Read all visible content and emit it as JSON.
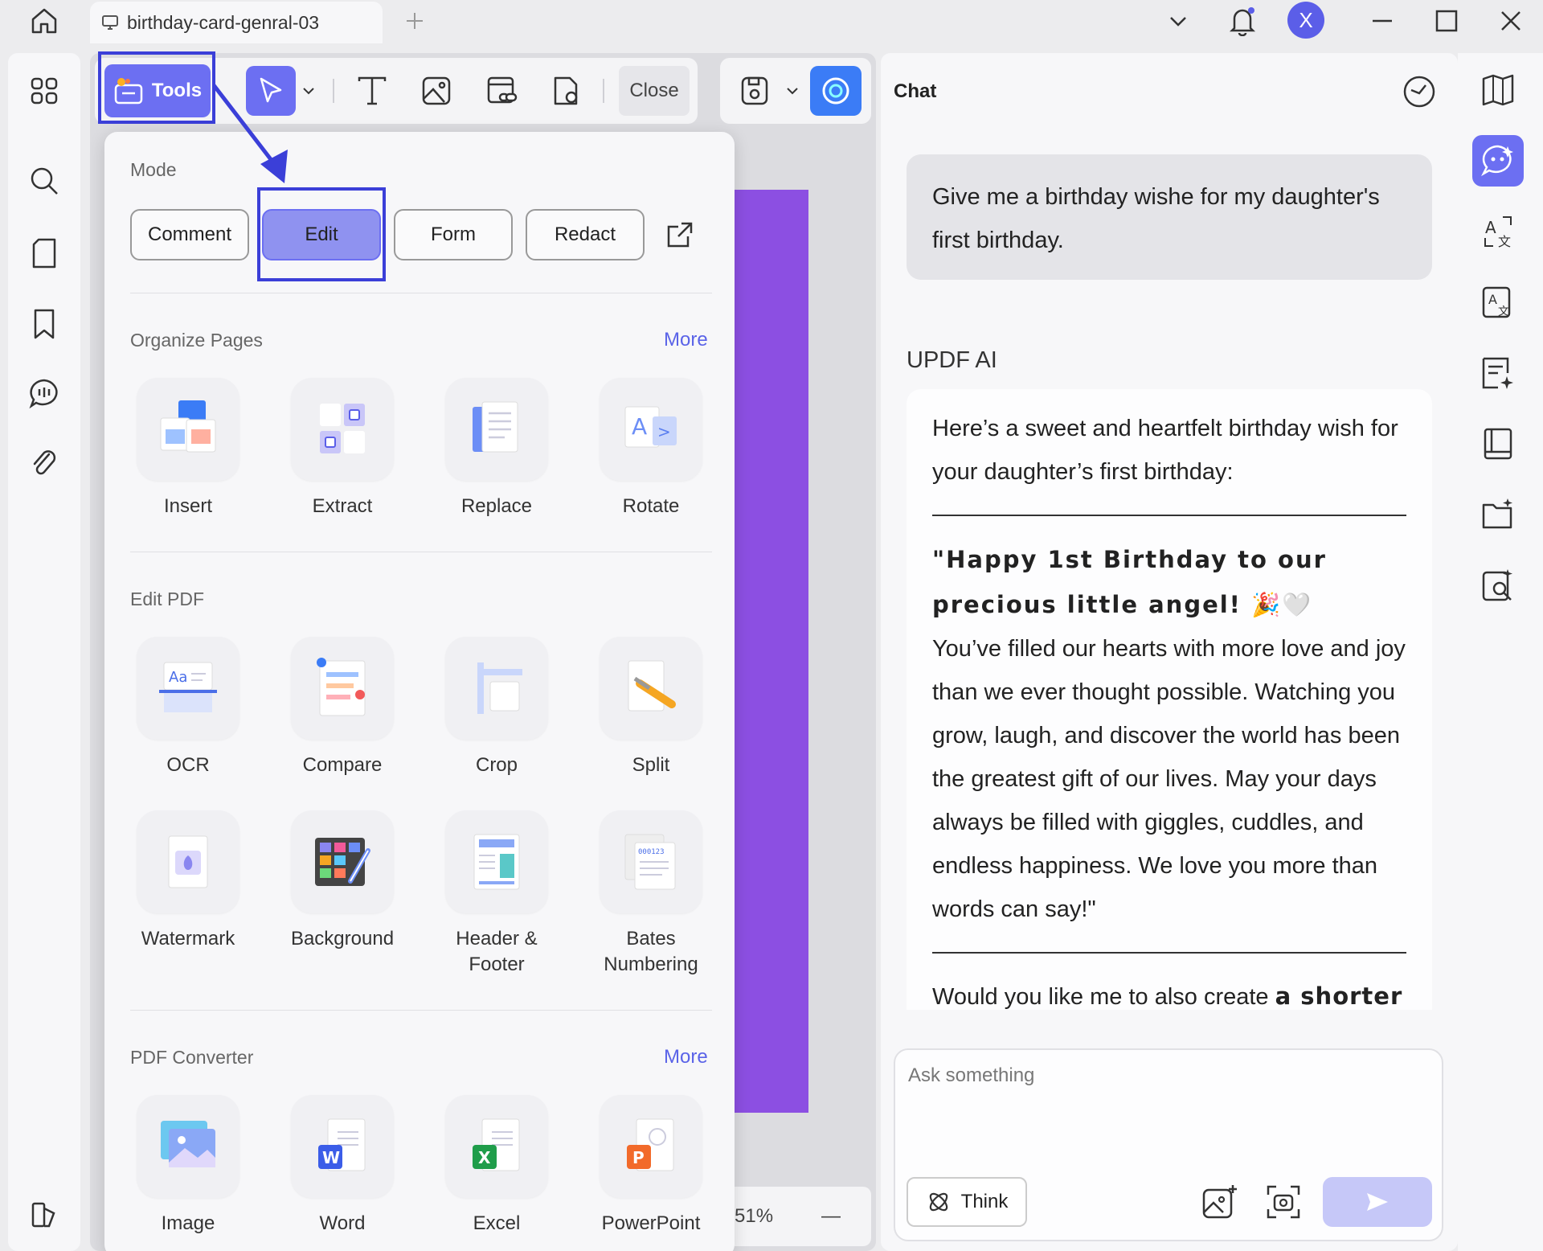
{
  "tab": {
    "title": "birthday-card-genral-03"
  },
  "user": {
    "avatar_initial": "X"
  },
  "toolbar": {
    "tools_label": "Tools",
    "close_label": "Close"
  },
  "zoom": {
    "value": "51%",
    "minus": "—"
  },
  "tools_panel": {
    "mode_title": "Mode",
    "modes": [
      "Comment",
      "Edit",
      "Form",
      "Redact"
    ],
    "organize": {
      "title": "Organize Pages",
      "more": "More",
      "items": [
        "Insert",
        "Extract",
        "Replace",
        "Rotate"
      ]
    },
    "edit_pdf": {
      "title": "Edit PDF",
      "items": [
        "OCR",
        "Compare",
        "Crop",
        "Split"
      ],
      "items2": [
        {
          "l1": "Watermark",
          "l2": ""
        },
        {
          "l1": "Background",
          "l2": ""
        },
        {
          "l1": "Header &",
          "l2": "Footer"
        },
        {
          "l1": "Bates",
          "l2": "Numbering"
        }
      ]
    },
    "converter": {
      "title": "PDF Converter",
      "more": "More",
      "items": [
        "Image",
        "Word",
        "Excel",
        "PowerPoint"
      ]
    }
  },
  "chat": {
    "title": "Chat",
    "user_message": "Give me a birthday wishe for my daughter's first birthday.",
    "ai_name": "UPDF AI",
    "ai_intro": "Here’s a sweet and heartfelt birthday wish for your daughter’s first birthday:",
    "wish_heading": "\"Happy 1st Birthday to our precious little angel! 🎉🤍",
    "wish_body": "You’ve filled our hearts with more love and joy than we ever thought possible. Watching you grow, laugh, and discover the world has been the greatest gift of our lives. May your days always be filled with giggles, cuddles, and endless happiness. We love you more than words can say!\"",
    "followup_prefix": "Would you like me to also create ",
    "followup_bold": "a shorter",
    "input_placeholder": "Ask something",
    "think_label": "Think"
  },
  "colors": {
    "accent": "#6c6ff2",
    "highlight": "#3b3fd8",
    "page": "#8c4fe2"
  }
}
